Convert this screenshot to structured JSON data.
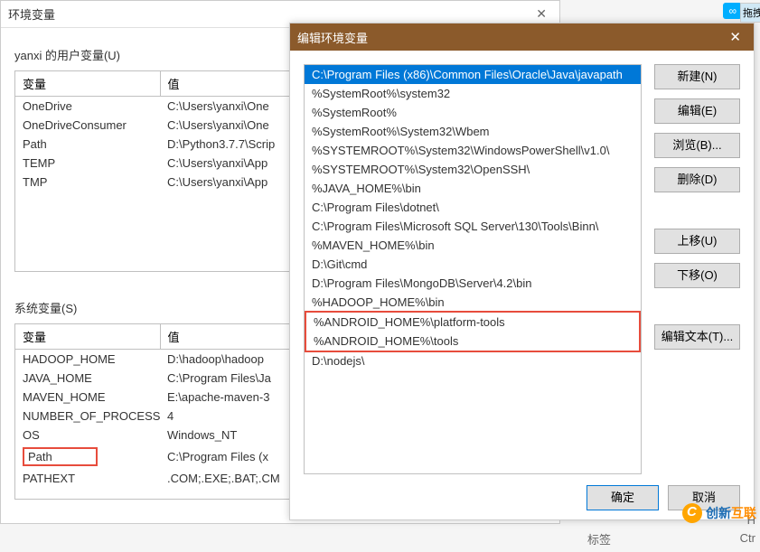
{
  "dialog1": {
    "title": "环境变量",
    "userVarsLabel": "yanxi 的用户变量(U)",
    "sysVarsLabel": "系统变量(S)",
    "colName": "变量",
    "colValue": "值",
    "userVars": [
      {
        "name": "OneDrive",
        "value": "C:\\Users\\yanxi\\One"
      },
      {
        "name": "OneDriveConsumer",
        "value": "C:\\Users\\yanxi\\One"
      },
      {
        "name": "Path",
        "value": "D:\\Python3.7.7\\Scrip"
      },
      {
        "name": "TEMP",
        "value": "C:\\Users\\yanxi\\App"
      },
      {
        "name": "TMP",
        "value": "C:\\Users\\yanxi\\App"
      }
    ],
    "sysVars": [
      {
        "name": "HADOOP_HOME",
        "value": "D:\\hadoop\\hadoop"
      },
      {
        "name": "JAVA_HOME",
        "value": "C:\\Program Files\\Ja"
      },
      {
        "name": "MAVEN_HOME",
        "value": "E:\\apache-maven-3"
      },
      {
        "name": "NUMBER_OF_PROCESSORS",
        "value": "4"
      },
      {
        "name": "OS",
        "value": "Windows_NT"
      },
      {
        "name": "Path",
        "value": "C:\\Program Files (x"
      },
      {
        "name": "PATHEXT",
        "value": ".COM;.EXE;.BAT;.CM"
      }
    ]
  },
  "dialog2": {
    "title": "编辑环境变量",
    "paths": [
      "C:\\Program Files (x86)\\Common Files\\Oracle\\Java\\javapath",
      "%SystemRoot%\\system32",
      "%SystemRoot%",
      "%SystemRoot%\\System32\\Wbem",
      "%SYSTEMROOT%\\System32\\WindowsPowerShell\\v1.0\\",
      "%SYSTEMROOT%\\System32\\OpenSSH\\",
      "%JAVA_HOME%\\bin",
      "C:\\Program Files\\dotnet\\",
      "C:\\Program Files\\Microsoft SQL Server\\130\\Tools\\Binn\\",
      "%MAVEN_HOME%\\bin",
      "D:\\Git\\cmd",
      "D:\\Program Files\\MongoDB\\Server\\4.2\\bin",
      "%HADOOP_HOME%\\bin",
      "%ANDROID_HOME%\\platform-tools",
      "%ANDROID_HOME%\\tools",
      "D:\\nodejs\\"
    ],
    "buttons": {
      "new": "新建(N)",
      "edit": "编辑(E)",
      "browse": "浏览(B)...",
      "delete": "删除(D)",
      "moveUp": "上移(U)",
      "moveDown": "下移(O)",
      "editText": "编辑文本(T)...",
      "ok": "确定",
      "cancel": "取消"
    }
  },
  "badges": {
    "infinity": "∞",
    "drag": "拖拽"
  },
  "bottom": {
    "label": "标签",
    "h": "H",
    "ctrl": "Ctr"
  },
  "watermark": {
    "text1": "创新",
    "text2": "互联"
  }
}
